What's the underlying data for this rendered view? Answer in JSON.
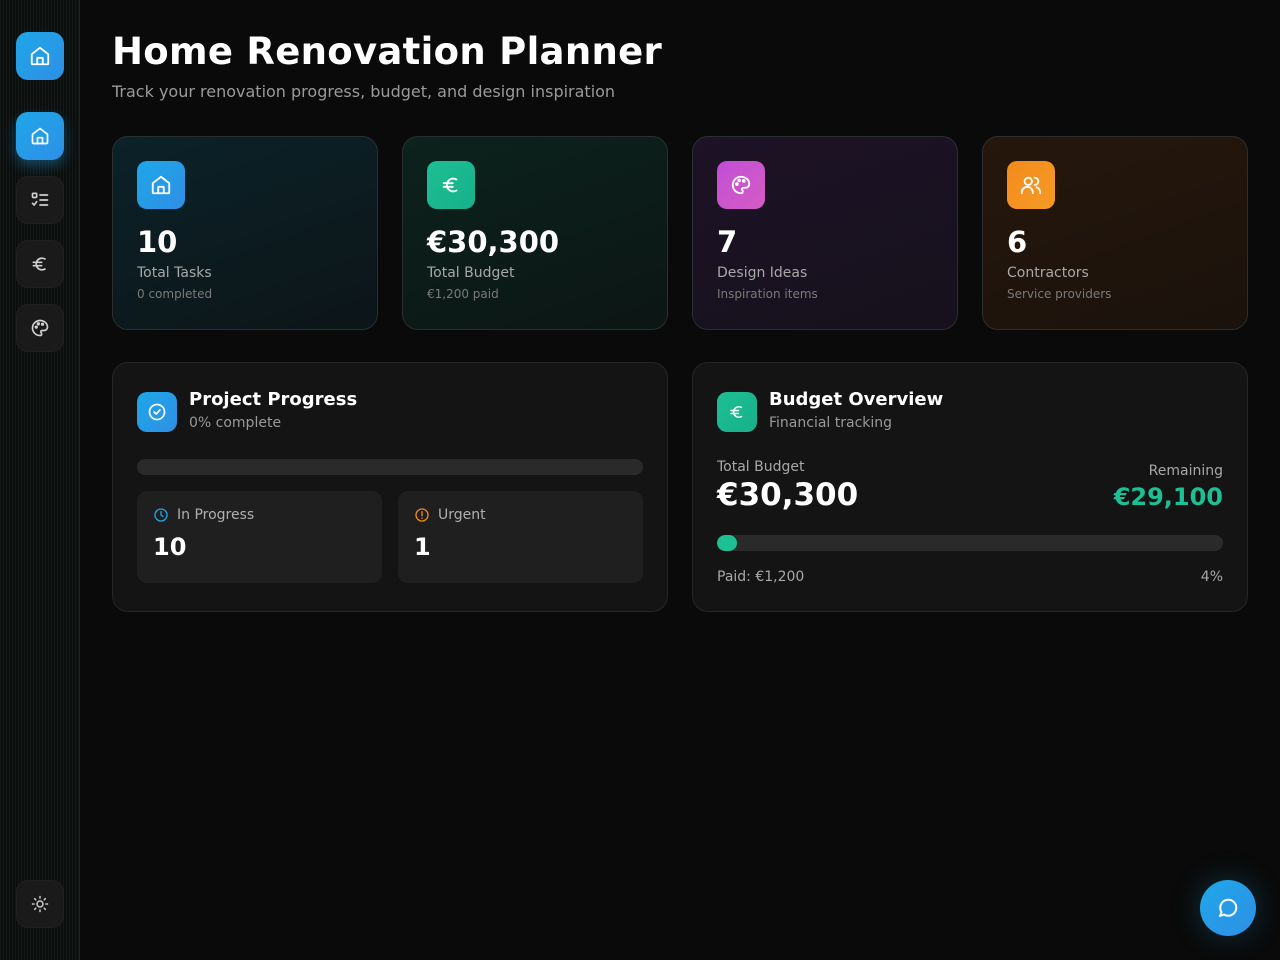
{
  "header": {
    "title": "Home Renovation Planner",
    "subtitle": "Track your renovation progress, budget, and design inspiration"
  },
  "sidebar": {
    "items": [
      {
        "name": "home",
        "icon": "home-icon",
        "active": true
      },
      {
        "name": "tasks",
        "icon": "checklist-icon",
        "active": false
      },
      {
        "name": "budget",
        "icon": "euro-icon",
        "active": false
      },
      {
        "name": "design",
        "icon": "palette-icon",
        "active": false
      }
    ],
    "theme_icon": "sun-icon"
  },
  "stats": [
    {
      "value": "10",
      "label": "Total Tasks",
      "sub": "0 completed",
      "icon": "home-icon",
      "color": "#2a9be6"
    },
    {
      "value": "€30,300",
      "label": "Total Budget",
      "sub": "€1,200 paid",
      "icon": "euro-icon",
      "color": "#1dbf94"
    },
    {
      "value": "7",
      "label": "Design Ideas",
      "sub": "Inspiration items",
      "icon": "palette-icon",
      "color": "#c14fd6"
    },
    {
      "value": "6",
      "label": "Contractors",
      "sub": "Service providers",
      "icon": "users-icon",
      "color": "#f38a1e"
    }
  ],
  "progress": {
    "title": "Project Progress",
    "subtitle": "0% complete",
    "percent": 0,
    "in_progress_label": "In Progress",
    "in_progress_value": "10",
    "urgent_label": "Urgent",
    "urgent_value": "1"
  },
  "budget": {
    "title": "Budget Overview",
    "subtitle": "Financial tracking",
    "total_label": "Total Budget",
    "total_value": "€30,300",
    "remaining_label": "Remaining",
    "remaining_value": "€29,100",
    "paid_text": "Paid: €1,200",
    "percent_text": "4%",
    "percent": 4
  },
  "colors": {
    "accent": "#2a9be6",
    "green": "#1dbf94",
    "purple": "#c14fd6",
    "orange": "#f38a1e"
  }
}
